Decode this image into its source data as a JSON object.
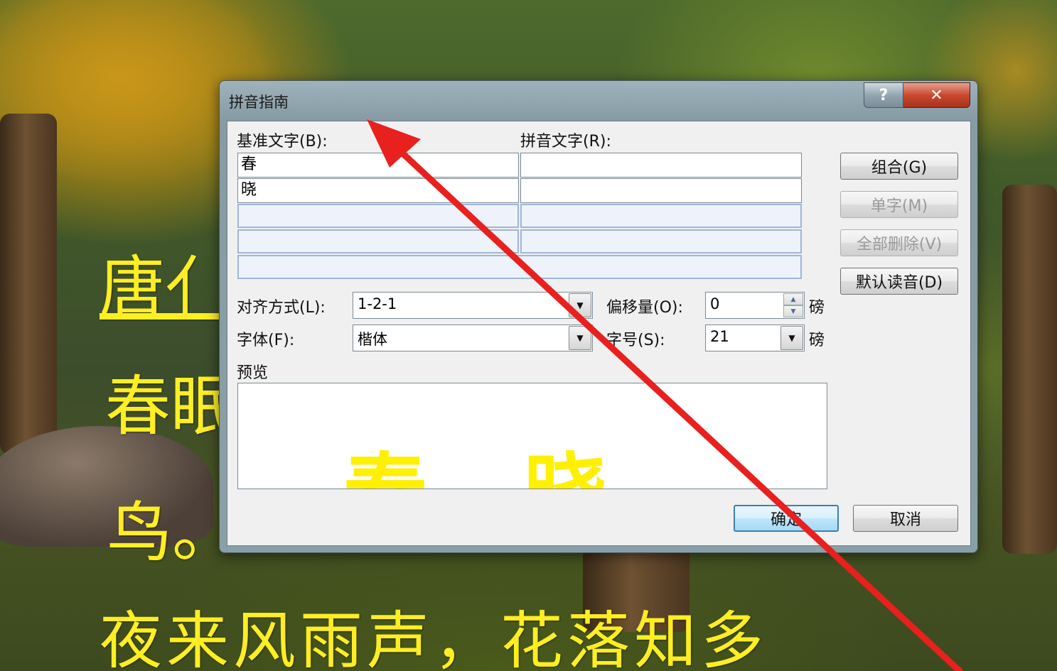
{
  "dialog": {
    "title": "拼音指南",
    "help_label": "?",
    "close_label": "✕",
    "base_text_label": "基准文字(B):",
    "pinyin_text_label": "拼音文字(R):",
    "rows": [
      {
        "base": "春",
        "pinyin": ""
      },
      {
        "base": "晓",
        "pinyin": ""
      },
      {
        "base": "",
        "pinyin": ""
      },
      {
        "base": "",
        "pinyin": ""
      },
      {
        "base": "",
        "pinyin": ""
      }
    ],
    "buttons": {
      "group": "组合(G)",
      "single": "单字(M)",
      "clear_all": "全部删除(V)",
      "default_reading": "默认读音(D)",
      "ok": "确定",
      "cancel": "取消"
    },
    "alignment_label": "对齐方式(L):",
    "alignment_value": "1-2-1",
    "offset_label": "偏移量(O):",
    "offset_value": "0",
    "offset_unit": "磅",
    "font_label": "字体(F):",
    "font_value": "楷体",
    "size_label": "字号(S):",
    "size_value": "21",
    "size_unit": "磅",
    "preview_label": "预览",
    "preview_chars": [
      "春",
      "晓"
    ]
  },
  "background_poem": {
    "line1": "唐亻",
    "line2": "春眠",
    "line3": "鸟。",
    "line4": "夜来风雨声，花落知多"
  },
  "colors": {
    "poem_text": "#ffee22",
    "arrow": "#e8201e",
    "default_button_border": "#3c7fb1"
  }
}
